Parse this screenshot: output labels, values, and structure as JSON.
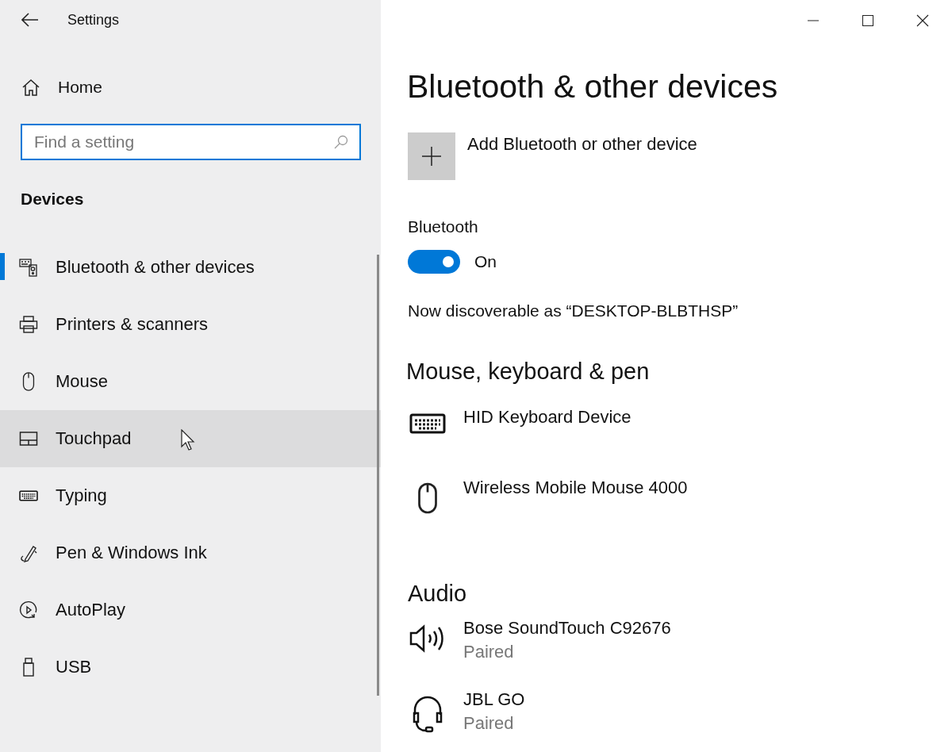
{
  "window": {
    "title": "Settings"
  },
  "sidebar": {
    "home": "Home",
    "search": {
      "placeholder": "Find a setting"
    },
    "section": "Devices",
    "items": [
      {
        "label": "Bluetooth & other devices",
        "kind": "bluetooth",
        "selected": true,
        "hovered": false
      },
      {
        "label": "Printers & scanners",
        "kind": "printer",
        "selected": false,
        "hovered": false
      },
      {
        "label": "Mouse",
        "kind": "mouse",
        "selected": false,
        "hovered": false
      },
      {
        "label": "Touchpad",
        "kind": "touchpad",
        "selected": false,
        "hovered": true
      },
      {
        "label": "Typing",
        "kind": "keyboard",
        "selected": false,
        "hovered": false
      },
      {
        "label": "Pen & Windows Ink",
        "kind": "pen",
        "selected": false,
        "hovered": false
      },
      {
        "label": "AutoPlay",
        "kind": "autoplay",
        "selected": false,
        "hovered": false
      },
      {
        "label": "USB",
        "kind": "usb",
        "selected": false,
        "hovered": false
      }
    ]
  },
  "page": {
    "title": "Bluetooth & other devices",
    "add_button": "Add Bluetooth or other device",
    "bluetooth": {
      "label": "Bluetooth",
      "on": true,
      "state_text": "On"
    },
    "discoverable": "Now discoverable as “DESKTOP-BLBTHSP”",
    "sections": [
      {
        "title": "Mouse, keyboard & pen",
        "devices": [
          {
            "name": "HID Keyboard Device",
            "kind": "keyboard"
          },
          {
            "name": "Wireless Mobile Mouse 4000",
            "kind": "mouse"
          }
        ]
      },
      {
        "title": "Audio",
        "devices": [
          {
            "name": "Bose SoundTouch C92676",
            "status": "Paired",
            "kind": "speaker"
          },
          {
            "name": "JBL GO",
            "status": "Paired",
            "kind": "headset"
          }
        ]
      }
    ]
  }
}
